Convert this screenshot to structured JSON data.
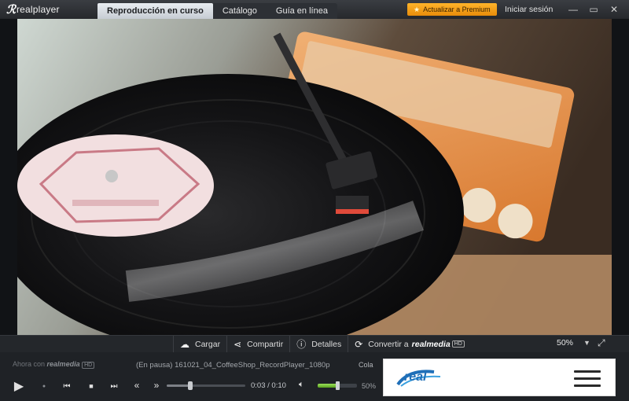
{
  "app": {
    "logo_text": "realplayer",
    "tabs": [
      {
        "label": "Reproducción en curso",
        "active": true
      },
      {
        "label": "Catálogo",
        "active": false
      },
      {
        "label": "Guía en línea",
        "active": false
      }
    ],
    "premium_label": "Actualizar a Premium",
    "signin_label": "Iniciar sesión",
    "window_controls": [
      "minimize-icon",
      "maximize-icon",
      "close-icon"
    ]
  },
  "actions": [
    {
      "label": "Cargar",
      "icon": "cloud-upload-icon"
    },
    {
      "label": "Compartir",
      "icon": "share-icon"
    },
    {
      "label": "Detalles",
      "icon": "info-icon"
    },
    {
      "label": "Convertir a",
      "icon": "convert-icon",
      "brand": "realmedia",
      "badge": "HD"
    }
  ],
  "zoom": {
    "value": "50%"
  },
  "info": {
    "prefix": "Ahora con",
    "brand": "realmedia",
    "badge": "HD"
  },
  "now_playing": {
    "status": "(En pausa)",
    "filename": "161021_04_CoffeeShop_RecordPlayer_1080p",
    "queue_label": "Cola"
  },
  "playback": {
    "current_time": "0:03",
    "duration": "0:10",
    "progress": 0.3,
    "volume_label": "50%",
    "volume": 0.5
  },
  "ad": {
    "logo_text": "real"
  },
  "colors": {
    "accent": "#f39c12",
    "volume": "#7bc13a",
    "background": "#1f2226"
  }
}
